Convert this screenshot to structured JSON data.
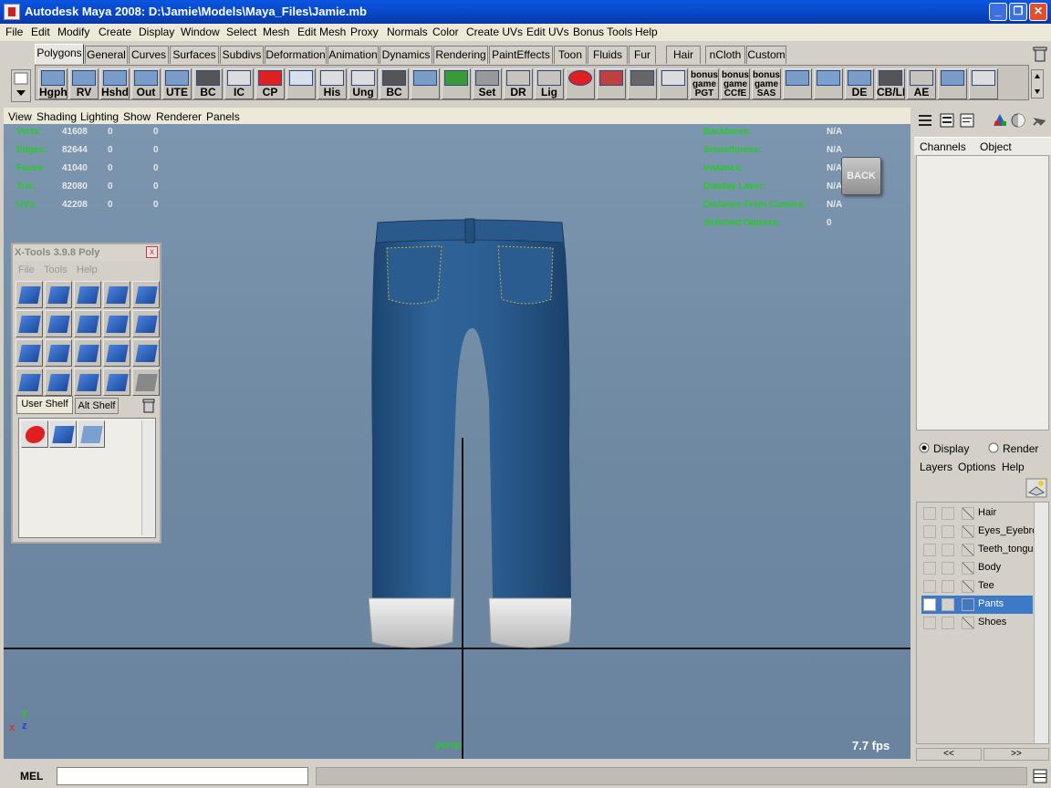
{
  "window": {
    "title": "Autodesk Maya 2008: D:\\Jamie\\Models\\Maya_Files\\Jamie.mb",
    "minimize": "_",
    "maximize": "❐",
    "close": "✕"
  },
  "menubar": [
    "File",
    "Edit",
    "Modify",
    "Create",
    "Display",
    "Window",
    "Select",
    "Mesh",
    "Edit Mesh",
    "Proxy",
    "Normals",
    "Color",
    "Create UVs",
    "Edit UVs",
    "Bonus Tools",
    "Help"
  ],
  "shelf_tabs": [
    "Polygons",
    "General",
    "Curves",
    "Surfaces",
    "Subdivs",
    "Deformation",
    "Animation",
    "Dynamics",
    "Rendering",
    "PaintEffects",
    "Toon",
    "Fluids",
    "Fur",
    "Hair",
    "nCloth",
    "Custom"
  ],
  "shelf_buttons": [
    "Hgph",
    "RV",
    "Hshd",
    "Out",
    "UTE",
    "BC",
    "IC",
    "CP",
    "",
    "His",
    "Ung",
    "BC",
    "",
    "",
    "Set",
    "DR",
    "Lig",
    "",
    "",
    "",
    "",
    "bonus game PGT",
    "bonus game CCfE",
    "bonus game SAS",
    "",
    "",
    "DE",
    "CB/LF",
    "AE",
    "",
    ""
  ],
  "panel_menu": [
    "View",
    "Shading",
    "Lighting",
    "Show",
    "Renderer",
    "Panels"
  ],
  "hud_left": [
    {
      "label": "Verts:",
      "a": "41608",
      "b": "0",
      "c": "0"
    },
    {
      "label": "Edges:",
      "a": "82644",
      "b": "0",
      "c": "0"
    },
    {
      "label": "Faces:",
      "a": "41040",
      "b": "0",
      "c": "0"
    },
    {
      "label": "Tris:",
      "a": "82080",
      "b": "0",
      "c": "0"
    },
    {
      "label": "UVs:",
      "a": "42208",
      "b": "0",
      "c": "0"
    }
  ],
  "hud_right": [
    {
      "label": "Backfaces:",
      "value": "N/A"
    },
    {
      "label": "Smoothness:",
      "value": "N/A"
    },
    {
      "label": "Instance:",
      "value": "N/A"
    },
    {
      "label": "Display Layer:",
      "value": "N/A"
    },
    {
      "label": "Distance From Camera:",
      "value": "N/A"
    },
    {
      "label": "Selected Objects:",
      "value": "0"
    }
  ],
  "viewport": {
    "back_button": "BACK",
    "fps": "7.7 fps",
    "camera": "persp",
    "axis_x": "x",
    "axis_y": "y",
    "axis_z": "z"
  },
  "xtools": {
    "title": "X-Tools 3.9.8 Poly",
    "close": "x",
    "menu": [
      "File",
      "Tools",
      "Help"
    ],
    "tabs": [
      "User Shelf",
      "Alt Shelf"
    ]
  },
  "channel_box": {
    "tabs": [
      "Channels",
      "Object"
    ]
  },
  "layer_editor": {
    "modes": [
      "Display",
      "Render"
    ],
    "menu": [
      "Layers",
      "Options",
      "Help"
    ],
    "layers": [
      {
        "name": "Hair",
        "v": ""
      },
      {
        "name": "Eyes_Eyebro",
        "v": ""
      },
      {
        "name": "Teeth_tongu",
        "v": ""
      },
      {
        "name": "Body",
        "v": ""
      },
      {
        "name": "Tee",
        "v": ""
      },
      {
        "name": "Pants",
        "v": "V",
        "selected": true
      },
      {
        "name": "Shoes",
        "v": ""
      }
    ],
    "nav": [
      "<<",
      ">>"
    ]
  },
  "command_line": {
    "label": "MEL",
    "value": ""
  },
  "colors": {
    "title_bar": "#0847c8",
    "viewport_bg": "#7d96b0",
    "hud_green": "#22cc22",
    "layer_selected": "#3c79c8",
    "denim": "#2a5a8c"
  }
}
